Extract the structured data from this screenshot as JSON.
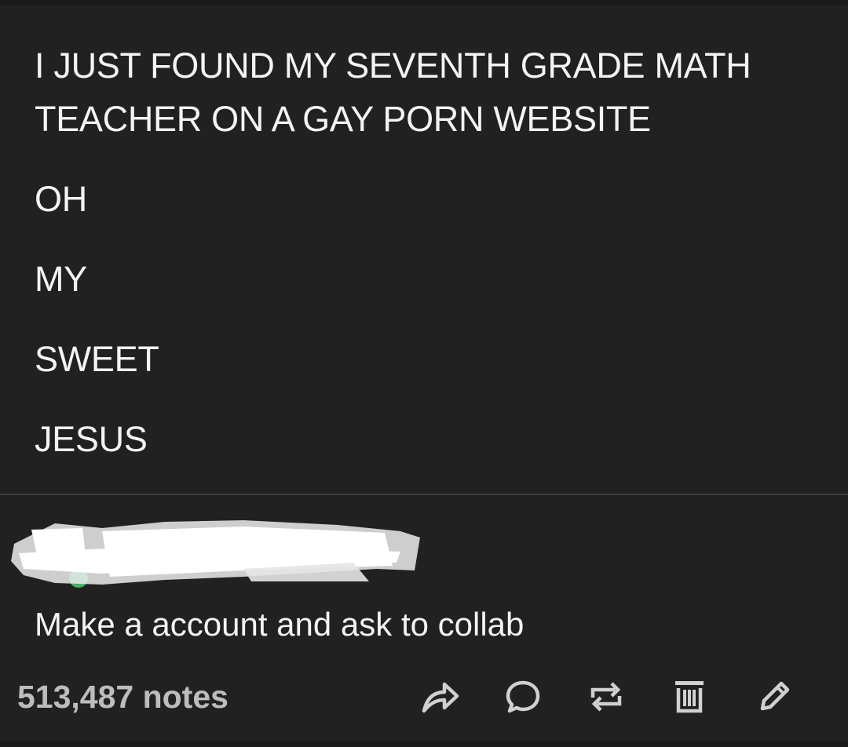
{
  "post": {
    "headline": "I JUST FOUND MY SEVENTH GRADE MATH TEACHER ON A GAY PORN WEBSITE",
    "lines": [
      "OH",
      "MY",
      "SWEET",
      "JESUS"
    ]
  },
  "reply": {
    "text": "Make a account and ask to collab"
  },
  "footer": {
    "notes": "513,487 notes",
    "icons": [
      "share-icon",
      "reply-icon",
      "reblog-icon",
      "delete-icon",
      "edit-icon"
    ]
  },
  "colors": {
    "background": "#212121",
    "text": "#f4f4f4",
    "muted": "#bdbdbd",
    "icon": "#d0d0d0"
  }
}
